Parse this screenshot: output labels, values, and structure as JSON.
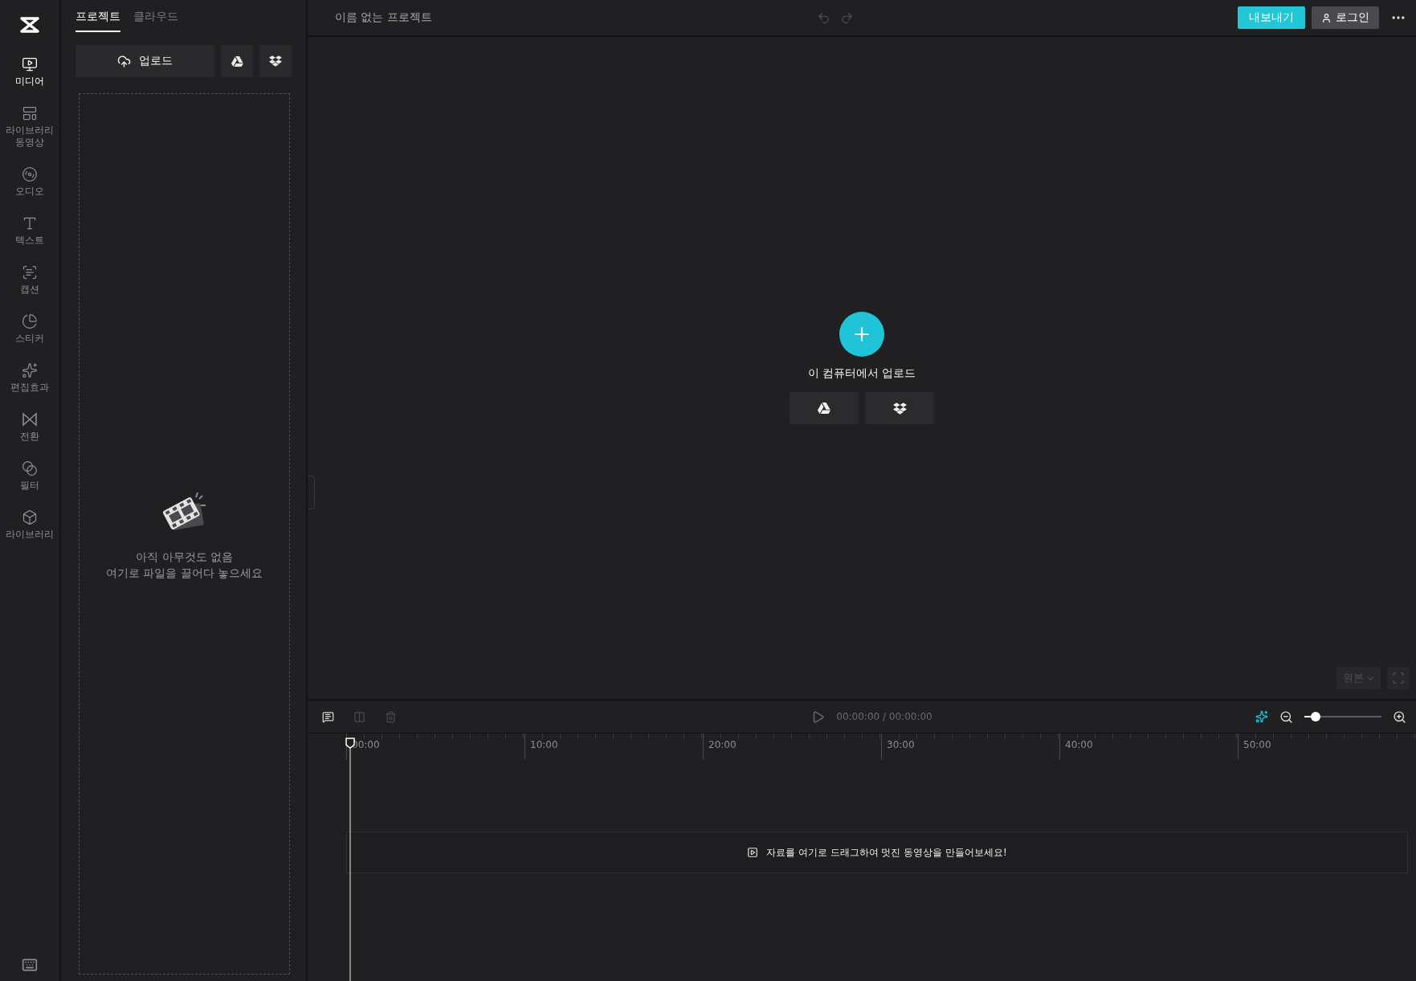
{
  "rail": {
    "items": [
      {
        "label": "미디어",
        "selected": true
      },
      {
        "label": "라이브러리\n동영상",
        "selected": false
      },
      {
        "label": "오디오",
        "selected": false
      },
      {
        "label": "텍스트",
        "selected": false
      },
      {
        "label": "캡션",
        "selected": false
      },
      {
        "label": "스티커",
        "selected": false
      },
      {
        "label": "편집효과",
        "selected": false
      },
      {
        "label": "전환",
        "selected": false
      },
      {
        "label": "필터",
        "selected": false
      },
      {
        "label": "라이브러리",
        "selected": false
      }
    ]
  },
  "panel": {
    "tabs": [
      {
        "label": "프로젝트",
        "selected": true
      },
      {
        "label": "클라우드",
        "selected": false
      }
    ],
    "upload_button": "업로드",
    "empty_title": "아직 아무것도 없음",
    "empty_hint": "여기로 파일을 끌어다 놓으세요"
  },
  "topbar": {
    "project_name": "이름 없는 프로젝트",
    "export_button": "내보내기",
    "login_button": "로그인"
  },
  "preview": {
    "upload_label": "이 컴퓨터에서 업로드",
    "ratio_button": "원본"
  },
  "timeline": {
    "time": "00:00:00 / 00:00:00",
    "zoom": {
      "level": 0.15
    },
    "ruler": [
      "00:00",
      "10:00",
      "20:00",
      "30:00",
      "40:00",
      "50:00"
    ],
    "drop_hint": "자료를 여기로 드래그하여 멋진 동영상을 만들어보세요!"
  }
}
